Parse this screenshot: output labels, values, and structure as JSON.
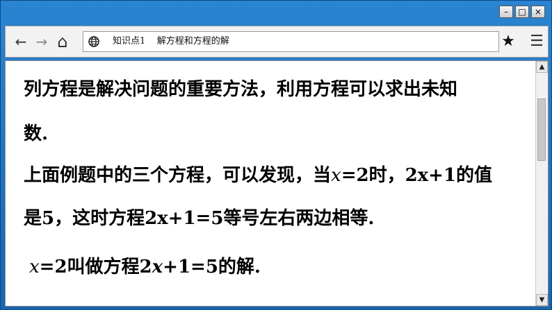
{
  "window": {
    "minimize_glyph": "–",
    "maximize_glyph": "□",
    "close_glyph": "×"
  },
  "toolbar": {
    "back_glyph": "←",
    "forward_glyph": "→",
    "home_glyph": "⌂",
    "address": "知识点1    解方程和方程的解",
    "star_glyph": "★",
    "menu_glyph": "☰"
  },
  "content": {
    "line1": "列方程是解决问题的重要方法，利用方程可以求出未知",
    "line2": "数.",
    "line3_a": "上面例题中的三个方程，可以发现，当",
    "line3_var": "x",
    "line3_b": "=2时，2x+1的值",
    "line4": "是5，这时方程2x+1=5等号左右两边相等.",
    "line5_var": "x",
    "line5_a": "=2叫做方程2",
    "line5_var2": "x",
    "line5_b": "+1=5的解."
  },
  "scrollbar": {
    "up_glyph": "▲",
    "down_glyph": "▼"
  },
  "colors": {
    "titlebar": "#1f74c2",
    "toolbar": "#f2f2f2",
    "content": "#ffffff"
  }
}
